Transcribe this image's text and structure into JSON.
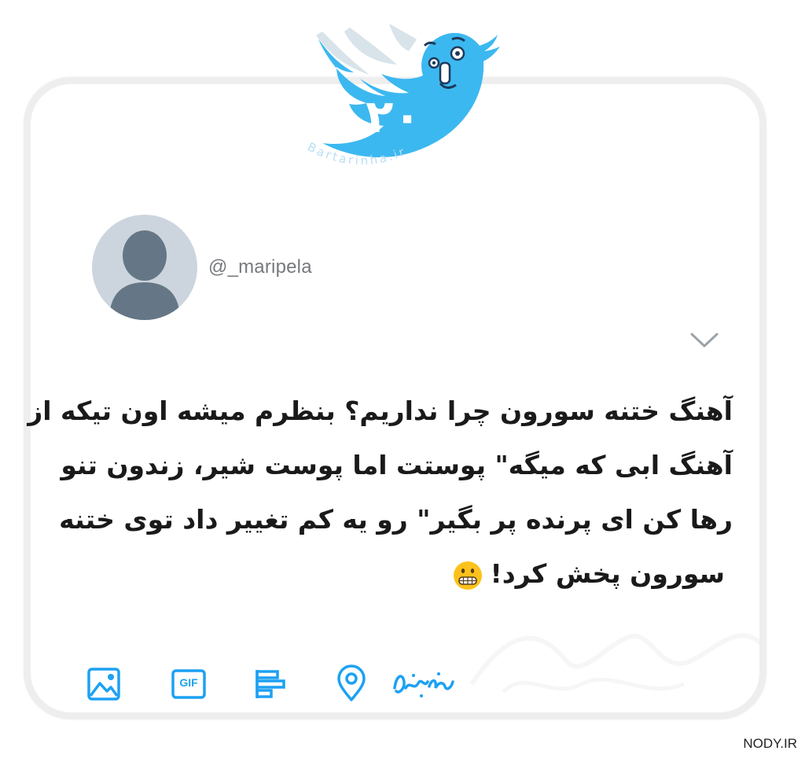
{
  "user": {
    "handle": "@_maripela"
  },
  "tweet": {
    "lines": [
      "آهنگ ختنه سورون چرا نداریم؟ بنظرم میشه اون تیکه از",
      "آهنگ ابی که میگه\" پوستت اما پوست شیر، زندون تنو",
      "رها کن ای پرنده پر بگیر\" رو یه کم تغییر داد توی ختنه",
      "سورون پخش کرد!"
    ],
    "emoji": "grimacing-face"
  },
  "logo": {
    "number": "۲۰",
    "brand_text": "Bartarinha.ir",
    "color": "#3cb8f0"
  },
  "toolbar": {
    "gif_label": "GIF",
    "items": [
      "image-icon",
      "gif-icon",
      "poll-icon",
      "location-icon",
      "bartarinha-logo-icon"
    ],
    "color": "#1da1f2"
  },
  "watermark": {
    "site": "NODY.IR"
  },
  "colors": {
    "text": "#1a1a1a",
    "handle": "#76797d",
    "avatar_bg": "#ccd5dd",
    "avatar_fg": "#657786",
    "card_border": "#eeeeee"
  }
}
